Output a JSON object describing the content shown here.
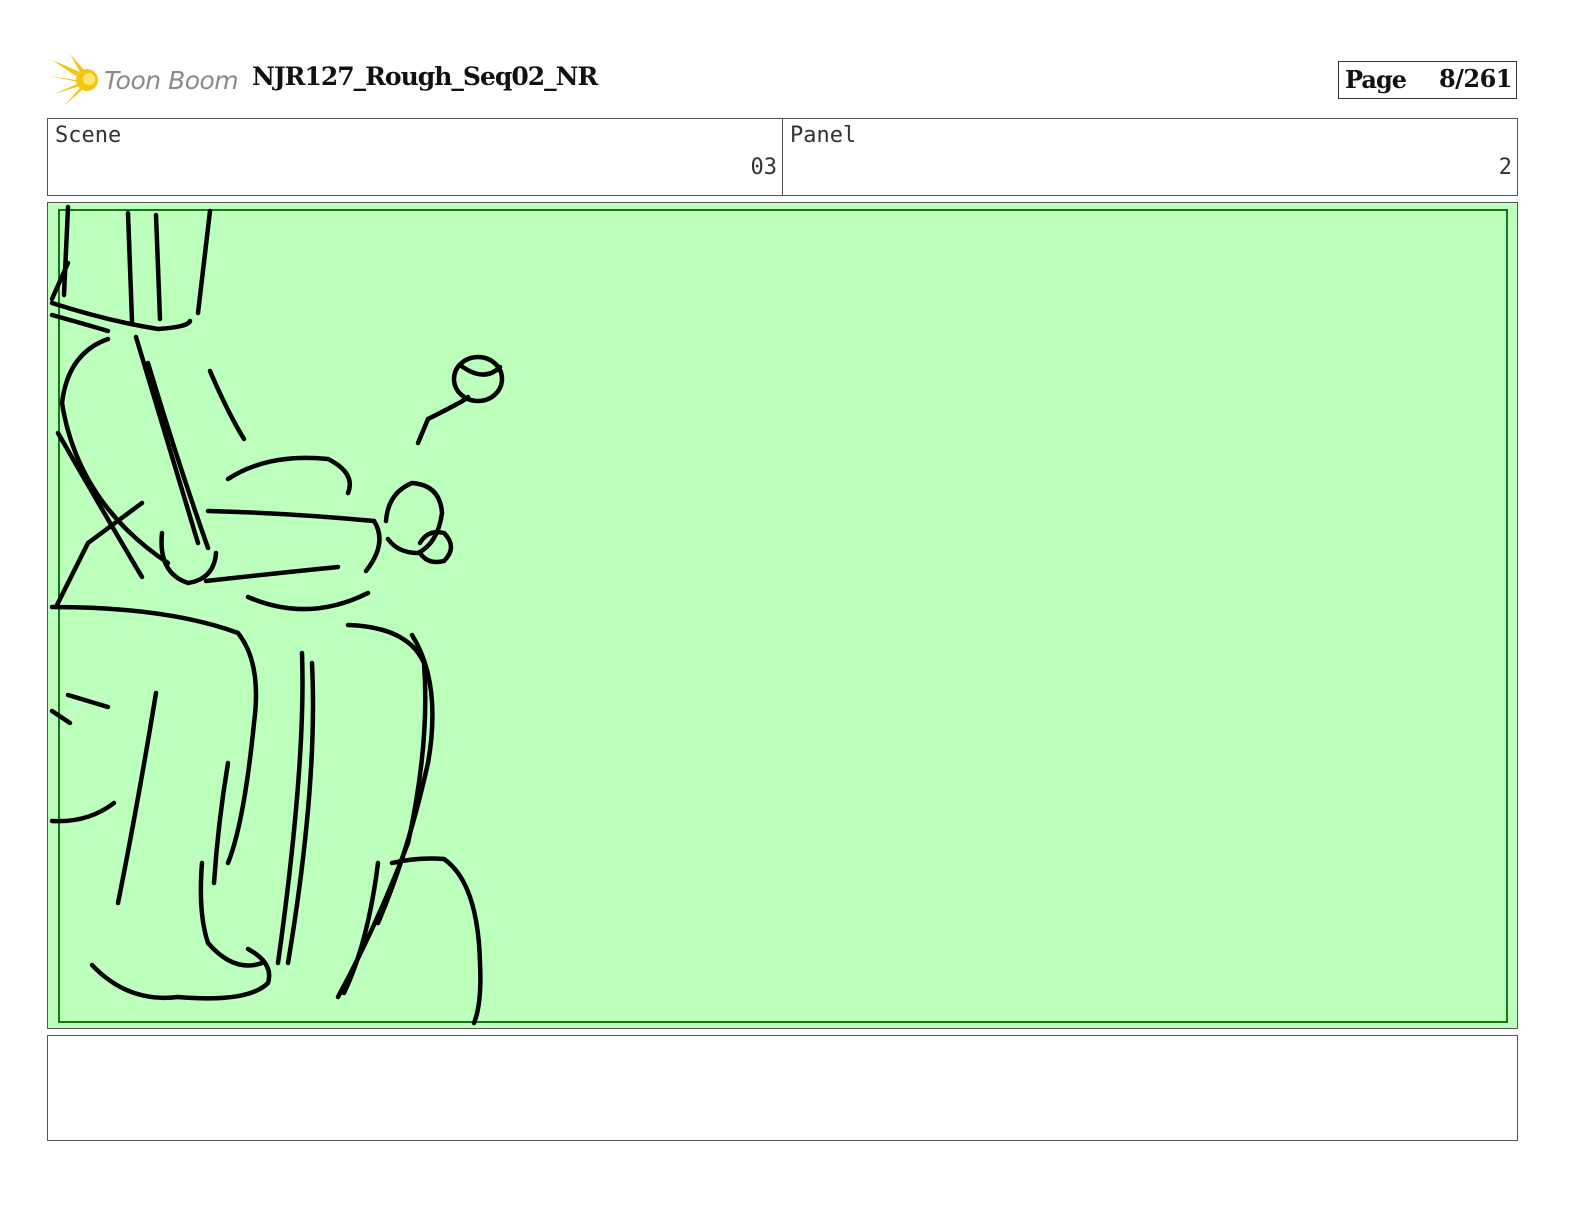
{
  "header": {
    "logo_text": "Toon Boom",
    "project_title": "NJR127_Rough_Seq02_NR",
    "page_label": "Page",
    "page_value": "8/261"
  },
  "info": {
    "scene_label": "Scene",
    "scene_value": "03",
    "panel_label": "Panel",
    "panel_value": "2"
  },
  "frame": {
    "background_color": "#bdffbc",
    "safe_area_color": "#117a11",
    "stroke_color": "#000000"
  },
  "notes": {
    "text": ""
  }
}
